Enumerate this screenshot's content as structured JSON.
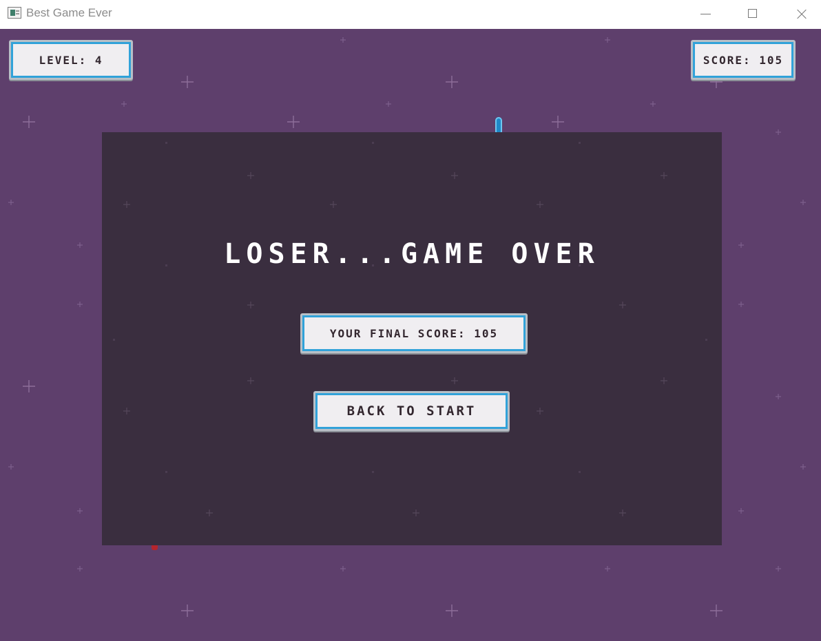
{
  "window": {
    "title": "Best Game Ever"
  },
  "hud": {
    "level_label": "LEVEL: 4",
    "score_label": "SCORE: 105"
  },
  "overlay": {
    "title": "LOSER...GAME OVER",
    "final_score_label": "YOUR FINAL SCORE: 105",
    "back_button_label": "BACK TO START"
  },
  "colors": {
    "background": "#5e3f6c",
    "overlay": "#3a2e3f",
    "box_fill": "#f0eef1",
    "box_border": "#31a2d9",
    "text_dark": "#33272f",
    "title_text": "#ffffff",
    "player_bullet": "#1f89c9",
    "enemy_bullet": "#b5252c"
  }
}
